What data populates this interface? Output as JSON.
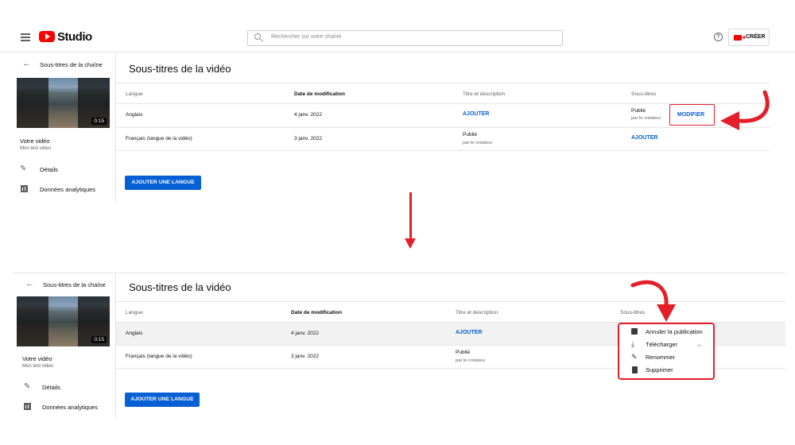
{
  "app": {
    "logo_text": "Studio",
    "search_placeholder": "Rechercher sur votre chaîne",
    "help_glyph": "?",
    "create_label": "CRÉER"
  },
  "sidebar": {
    "back_title": "Sous-titres de la chaîne",
    "duration": "0:15",
    "video_title": "Votre vidéo",
    "video_subtitle": "Mon test video",
    "nav": [
      {
        "label": "Détails",
        "icon": "pencil-icon"
      },
      {
        "label": "Données analytiques",
        "icon": "analytics-icon"
      }
    ]
  },
  "main": {
    "title": "Sous-titres de la vidéo",
    "columns": [
      "Langue",
      "Date de modification",
      "Titre et description",
      "Sous-titres"
    ],
    "rows": [
      {
        "language": "Anglais",
        "date": "4 janv. 2022",
        "title_desc": "AJOUTER",
        "subtitle_status": "Publié",
        "subtitle_by": "par le créateur",
        "subtitle_action": "MODIFIER"
      },
      {
        "language": "Français (langue de la vidéo)",
        "date": "3 janv. 2022",
        "title_desc_status": "Publié",
        "title_desc_by": "par le créateur",
        "subtitle_action": "AJOUTER"
      }
    ],
    "add_language_label": "AJOUTER UNE LANGUE"
  },
  "menu": {
    "items": [
      {
        "label": "Annuler la publication",
        "icon": "unpublish-icon"
      },
      {
        "label": "Télécharger",
        "icon": "download-icon",
        "submenu_arrow": "→"
      },
      {
        "label": "Renommer",
        "icon": "pencil-icon"
      },
      {
        "label": "Supprimer",
        "icon": "trash-icon"
      }
    ]
  },
  "colors": {
    "brand_red": "#ff0000",
    "link_blue": "#065fd4",
    "annotation_red": "#e3202a"
  }
}
